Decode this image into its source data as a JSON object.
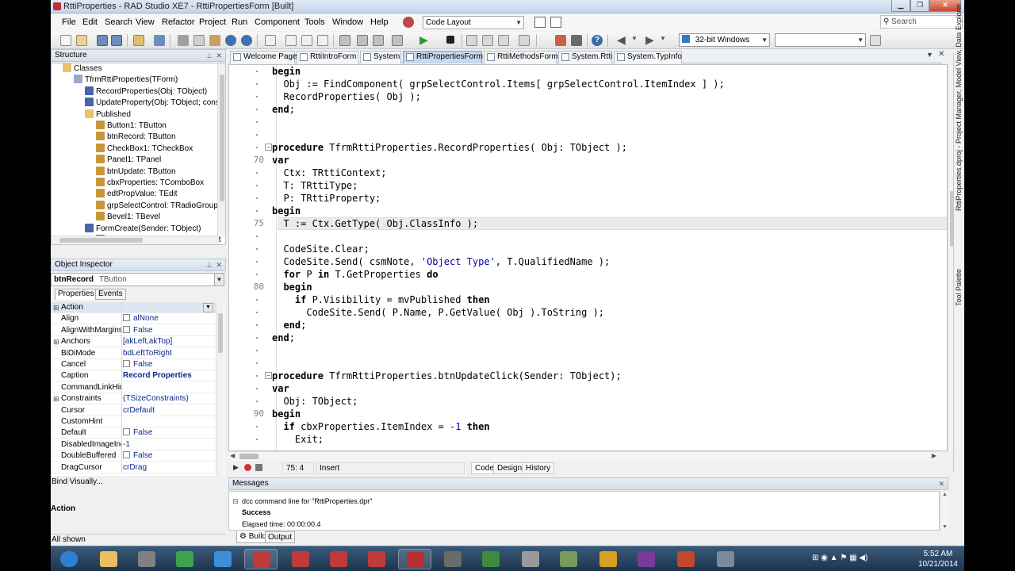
{
  "window": {
    "title": "RttiProperties - RAD Studio XE7 - RttiPropertiesForm [Built]",
    "minimize": "▁",
    "maximize": "❐",
    "close": "✕"
  },
  "menu": {
    "items": [
      "File",
      "Edit",
      "Search",
      "View",
      "Refactor",
      "Project",
      "Run",
      "Component",
      "Tools",
      "Window",
      "Help"
    ],
    "layout_combo": "Code Layout",
    "search_placeholder": "Search"
  },
  "toolbar": {
    "platform": "32-bit Windows",
    "config": ""
  },
  "structure": {
    "title": "Structure",
    "nodes": [
      {
        "label": "Classes",
        "icon": "folder-icon"
      },
      {
        "label": "TfrmRttiProperties(TForm)",
        "icon": "class-icon"
      },
      {
        "label": "RecordProperties(Obj: TObject)",
        "icon": "method-icon"
      },
      {
        "label": "UpdateProperty(Obj: TObject; cons",
        "icon": "method-icon"
      },
      {
        "label": "Published",
        "icon": "folder-icon"
      },
      {
        "label": "Button1: TButton",
        "icon": "field-icon"
      },
      {
        "label": "btnRecord: TButton",
        "icon": "field-icon"
      },
      {
        "label": "CheckBox1: TCheckBox",
        "icon": "field-icon"
      },
      {
        "label": "Panel1: TPanel",
        "icon": "field-icon"
      },
      {
        "label": "btnUpdate: TButton",
        "icon": "field-icon"
      },
      {
        "label": "cbxProperties: TComboBox",
        "icon": "field-icon"
      },
      {
        "label": "edtPropValue: TEdit",
        "icon": "field-icon"
      },
      {
        "label": "grpSelectControl: TRadioGroup",
        "icon": "field-icon"
      },
      {
        "label": "Bevel1: TBevel",
        "icon": "field-icon"
      },
      {
        "label": "FormCreate(Sender: TObject)",
        "icon": "method-icon"
      },
      {
        "label": "btnRecordClick(Sender: TObject",
        "icon": "method-icon"
      }
    ]
  },
  "inspector": {
    "title": "Object Inspector",
    "object_name": "btnRecord",
    "object_type": "TButton",
    "tabs": [
      "Properties",
      "Events"
    ],
    "rows": [
      {
        "name": "Action",
        "value": "",
        "plus": "⊞",
        "checkbox": false,
        "bold": false,
        "selected": true
      },
      {
        "name": "Align",
        "value": "alNone",
        "plus": "",
        "checkbox": true,
        "bold": false
      },
      {
        "name": "AlignWithMargins",
        "value": "False",
        "plus": "",
        "checkbox": true,
        "bold": false
      },
      {
        "name": "Anchors",
        "value": "[akLeft,akTop]",
        "plus": "⊞",
        "checkbox": false,
        "bold": false
      },
      {
        "name": "BiDiMode",
        "value": "bdLeftToRight",
        "plus": "",
        "checkbox": false,
        "bold": false
      },
      {
        "name": "Cancel",
        "value": "False",
        "plus": "",
        "checkbox": true,
        "bold": false
      },
      {
        "name": "Caption",
        "value": "Record Properties",
        "plus": "",
        "checkbox": false,
        "bold": true
      },
      {
        "name": "CommandLinkHint",
        "value": "",
        "plus": "",
        "checkbox": false,
        "bold": false
      },
      {
        "name": "Constraints",
        "value": "(TSizeConstraints)",
        "plus": "⊞",
        "checkbox": false,
        "bold": false
      },
      {
        "name": "Cursor",
        "value": "crDefault",
        "plus": "",
        "checkbox": false,
        "bold": false
      },
      {
        "name": "CustomHint",
        "value": "",
        "plus": "",
        "checkbox": false,
        "bold": false
      },
      {
        "name": "Default",
        "value": "False",
        "plus": "",
        "checkbox": true,
        "bold": false
      },
      {
        "name": "DisabledImageIndex",
        "value": "-1",
        "plus": "",
        "checkbox": false,
        "bold": false
      },
      {
        "name": "DoubleBuffered",
        "value": "False",
        "plus": "",
        "checkbox": true,
        "bold": false
      },
      {
        "name": "DragCursor",
        "value": "crDrag",
        "plus": "",
        "checkbox": false,
        "bold": false
      }
    ],
    "bind_visually": "Bind Visually...",
    "action_label": "Action",
    "all_shown": "All shown"
  },
  "editor_tabs": [
    {
      "label": "Welcome Page",
      "active": false
    },
    {
      "label": "RttiIntroForm",
      "active": false
    },
    {
      "label": "System",
      "active": false
    },
    {
      "label": "RttiPropertiesForm",
      "active": true
    },
    {
      "label": "RttiMethodsForm",
      "active": false
    },
    {
      "label": "System.Rtti",
      "active": false
    },
    {
      "label": "System.TypInfo",
      "active": false
    }
  ],
  "code": {
    "current_line_index": 12,
    "lines": [
      {
        "n": "",
        "t": "begin",
        "fold": ""
      },
      {
        "n": "",
        "t": "  Obj := FindComponent( grpSelectControl.Items[ grpSelectControl.ItemIndex ] );",
        "fold": ""
      },
      {
        "n": "",
        "t": "  RecordProperties( Obj );",
        "fold": ""
      },
      {
        "n": "",
        "t": "end;",
        "fold": ""
      },
      {
        "n": "",
        "t": "",
        "fold": ""
      },
      {
        "n": "",
        "t": "",
        "fold": ""
      },
      {
        "n": "",
        "t": "procedure TfrmRttiProperties.RecordProperties( Obj: TObject );",
        "fold": "−"
      },
      {
        "n": "70",
        "t": "var",
        "fold": ""
      },
      {
        "n": "",
        "t": "  Ctx: TRttiContext;",
        "fold": ""
      },
      {
        "n": "",
        "t": "  T: TRttiType;",
        "fold": ""
      },
      {
        "n": "",
        "t": "  P: TRttiProperty;",
        "fold": ""
      },
      {
        "n": "",
        "t": "begin",
        "fold": ""
      },
      {
        "n": "75",
        "t": "  T := Ctx.GetType( Obj.ClassInfo );",
        "fold": ""
      },
      {
        "n": "",
        "t": "",
        "fold": ""
      },
      {
        "n": "",
        "t": "  CodeSite.Clear;",
        "fold": ""
      },
      {
        "n": "",
        "t": "  CodeSite.Send( csmNote, 'Object Type', T.QualifiedName );",
        "fold": ""
      },
      {
        "n": "",
        "t": "  for P in T.GetProperties do",
        "fold": ""
      },
      {
        "n": "80",
        "t": "  begin",
        "fold": ""
      },
      {
        "n": "",
        "t": "    if P.Visibility = mvPublished then",
        "fold": ""
      },
      {
        "n": "",
        "t": "      CodeSite.Send( P.Name, P.GetValue( Obj ).ToString );",
        "fold": ""
      },
      {
        "n": "",
        "t": "  end;",
        "fold": ""
      },
      {
        "n": "",
        "t": "end;",
        "fold": ""
      },
      {
        "n": "",
        "t": "",
        "fold": ""
      },
      {
        "n": "",
        "t": "",
        "fold": ""
      },
      {
        "n": "",
        "t": "procedure TfrmRttiProperties.btnUpdateClick(Sender: TObject);",
        "fold": "−"
      },
      {
        "n": "",
        "t": "var",
        "fold": ""
      },
      {
        "n": "",
        "t": "  Obj: TObject;",
        "fold": ""
      },
      {
        "n": "90",
        "t": "begin",
        "fold": ""
      },
      {
        "n": "",
        "t": "  if cbxProperties.ItemIndex = -1 then",
        "fold": ""
      },
      {
        "n": "",
        "t": "    Exit;",
        "fold": ""
      }
    ]
  },
  "status": {
    "position": "75:  4",
    "mode": "Insert",
    "views": [
      "Code",
      "Design",
      "History"
    ]
  },
  "messages": {
    "title": "Messages",
    "line1": "dcc command line for \"RttiProperties.dpr\"",
    "success": "Success",
    "elapsed": "Elapsed time: 00:00:00.4",
    "tabs": [
      "Build",
      "Output"
    ]
  },
  "right_palette": {
    "label1": "Tool Palette",
    "label2": "RttiProperties.dproj - Project Manager, Model View, Data Explorer"
  },
  "taskbar": {
    "time": "5:52 AM",
    "date": "10/21/2014",
    "apps": [
      {
        "name": "start-orb-icon",
        "color": "#2f7fd0"
      },
      {
        "name": "file-explorer-icon",
        "color": "#e8c060"
      },
      {
        "name": "calculator-icon",
        "color": "#808080"
      },
      {
        "name": "chrome-icon",
        "color": "#3fa34d"
      },
      {
        "name": "internet-explorer-icon",
        "color": "#3b8fd8"
      },
      {
        "name": "rad-studio-icon-1",
        "color": "#c03a3a"
      },
      {
        "name": "rad-studio-icon-2",
        "color": "#c03a3a"
      },
      {
        "name": "rad-studio-icon-3",
        "color": "#c03a3a"
      },
      {
        "name": "rad-studio-icon-4",
        "color": "#c03a3a"
      },
      {
        "name": "rad-studio-icon-5",
        "color": "#b83030"
      },
      {
        "name": "tools-icon",
        "color": "#6a6a6a"
      },
      {
        "name": "paint-icon",
        "color": "#3c8c3c"
      },
      {
        "name": "document-icon",
        "color": "#9a9a9a"
      },
      {
        "name": "codesite-icon",
        "color": "#7a9a5a"
      },
      {
        "name": "outlook-icon",
        "color": "#d8a020"
      },
      {
        "name": "onenote-icon",
        "color": "#7a3a9a"
      },
      {
        "name": "powerpoint-icon",
        "color": "#c04a28"
      },
      {
        "name": "window-icon",
        "color": "#7a8a9a"
      }
    ]
  }
}
